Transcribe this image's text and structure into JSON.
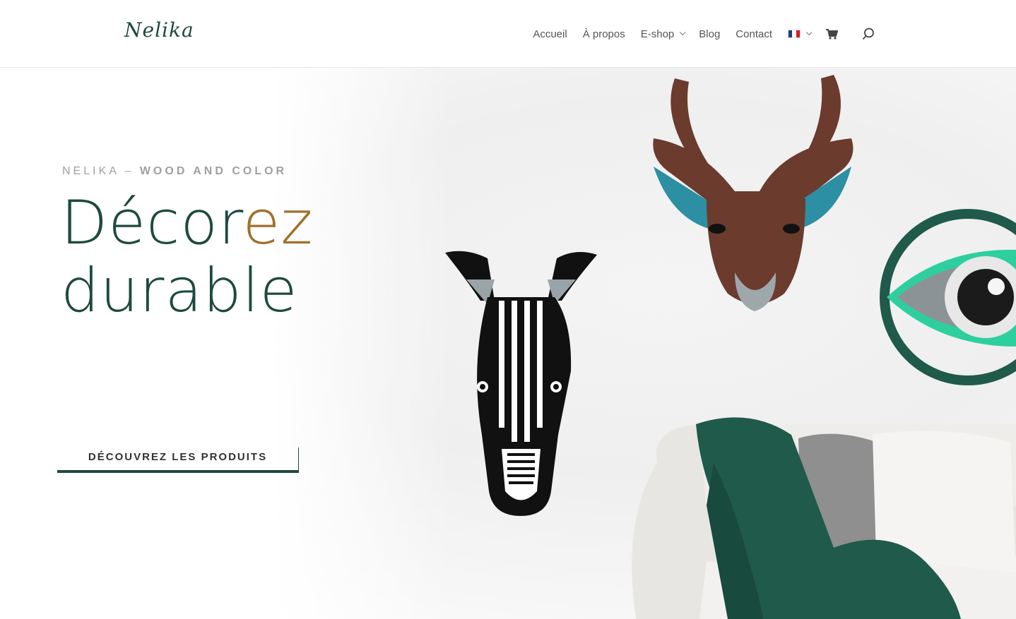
{
  "header": {
    "logo_text": "Nelika",
    "nav": [
      {
        "label": "Accueil",
        "has_dropdown": false
      },
      {
        "label": "À propos",
        "has_dropdown": false
      },
      {
        "label": "E-shop",
        "has_dropdown": true
      },
      {
        "label": "Blog",
        "has_dropdown": false
      },
      {
        "label": "Contact",
        "has_dropdown": false
      }
    ],
    "language_flag": "fr-flag-icon",
    "cart_icon": "cart-icon",
    "search_icon": "search-icon"
  },
  "hero": {
    "eyebrow_light": "NELIKA – ",
    "eyebrow_bold": "WOOD AND COLOR",
    "headline_line1_main": "Décor",
    "headline_line1_accent": "ez",
    "headline_line2": "durable",
    "cta_label": "DÉCOUVREZ LES PRODUITS"
  },
  "colors": {
    "brand_green": "#1e4a3f",
    "accent_gold": "#a0702a",
    "eyebrow_gray": "#a0a0a0"
  }
}
